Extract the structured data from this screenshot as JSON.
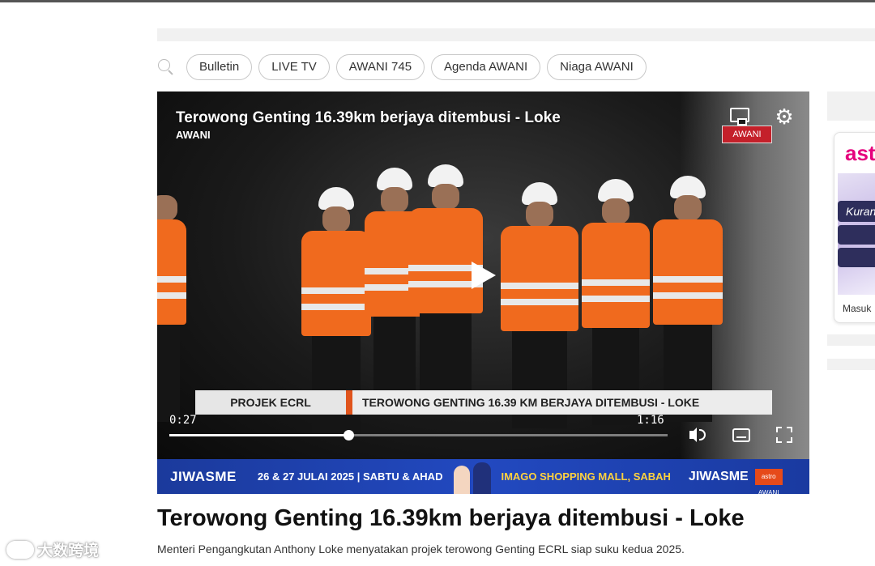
{
  "nav": {
    "search_icon": "search-icon",
    "tags": [
      "Bulletin",
      "LIVE TV",
      "AWANI 745",
      "Agenda AWANI",
      "Niaga AWANI"
    ]
  },
  "video": {
    "overlay_title": "Terowong Genting 16.39km berjaya ditembusi - Loke",
    "overlay_source": "AWANI",
    "channel_logo": "AWANI",
    "lower_third_label": "PROJEK ECRL",
    "lower_third_headline": "TEROWONG GENTING 16.39 KM BERJAYA DITEMBUSI - LOKE",
    "current_time": "0:27",
    "duration": "1:16",
    "progress": 0.36,
    "icons": [
      "cast-icon",
      "gear-icon",
      "play-icon",
      "volume-icon",
      "captions-icon",
      "fullscreen-icon"
    ]
  },
  "banner": {
    "brand": "JIWASME",
    "date_text": "26 & 27 JULAI 2025 | SABTU & AHAD",
    "venue": "IMAGO SHOPPING MALL, SABAH",
    "brand_right": "JIWASME",
    "sponsor": "astro AWANI"
  },
  "article": {
    "title": "Terowong Genting 16.39km berjaya ditembusi - Loke",
    "description": "Menteri Pengangkutan Anthony Loke menyatakan projek terowong Genting ECRL siap suku kedua 2025."
  },
  "sidebar": {
    "logo": "ast",
    "button_text": "Kuran",
    "footer_text": "Masuk"
  },
  "watermark": "大数跨境",
  "colors": {
    "accent": "#f06a1e",
    "banner_blue": "#2249c0",
    "awani_red": "#c4202a"
  }
}
